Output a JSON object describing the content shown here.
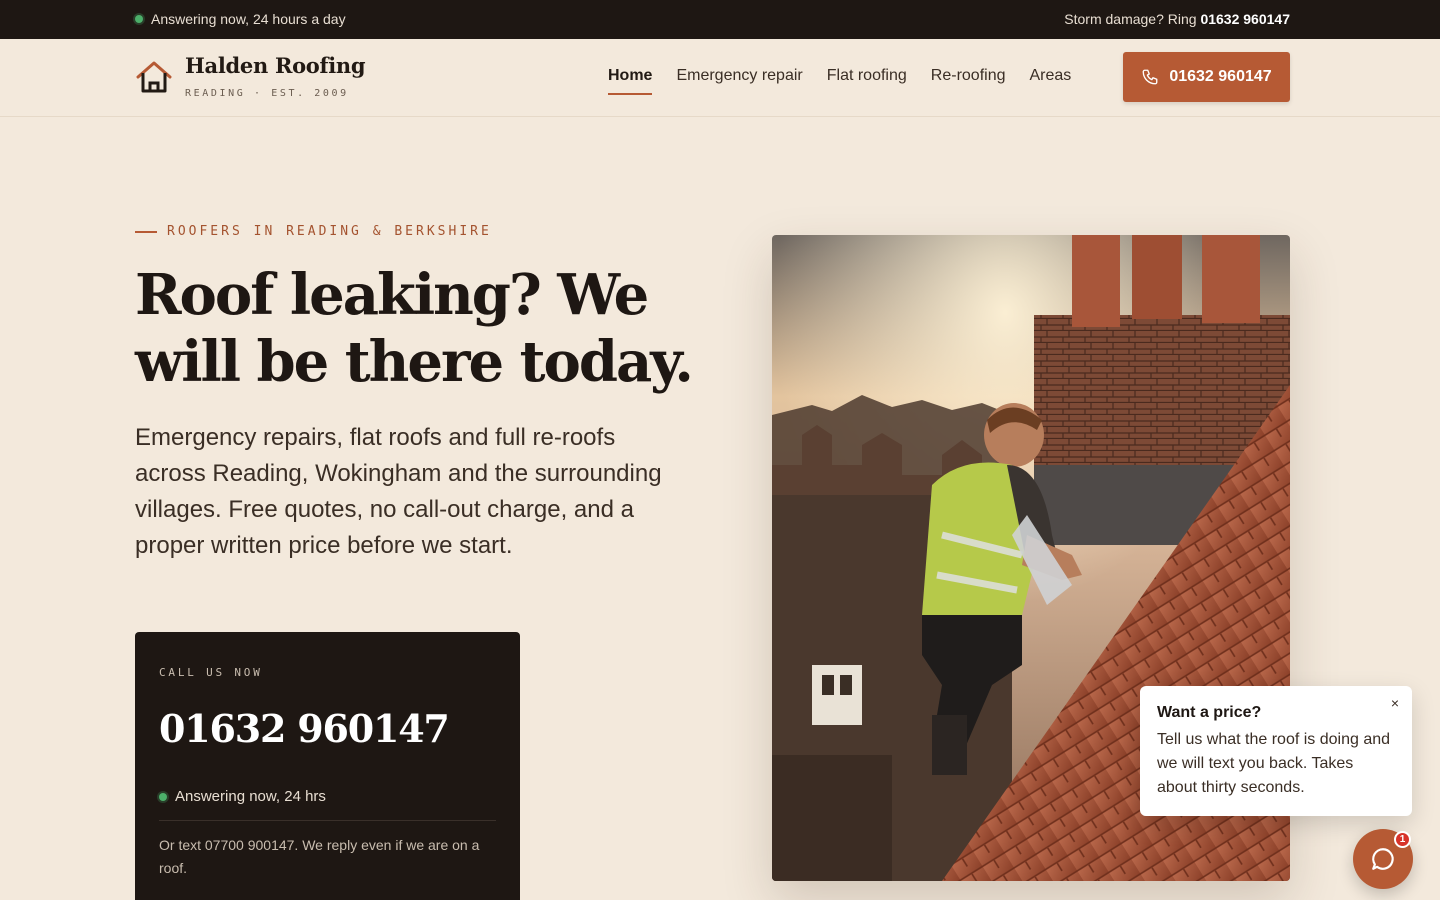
{
  "topbar": {
    "status": "Answering now, 24 hours a day",
    "storm_prefix": "Storm damage? Ring",
    "storm_phone": "01632 960147"
  },
  "header": {
    "brand": "Halden Roofing",
    "tagline": "READING · EST. 2009",
    "nav": [
      "Home",
      "Emergency repair",
      "Flat roofing",
      "Re-roofing",
      "Areas"
    ],
    "active_nav": "Home",
    "cta_phone": "01632 960147"
  },
  "hero": {
    "eyebrow": "ROOFERS IN READING & BERKSHIRE",
    "headline": "Roof leaking? We will be there today.",
    "lede": "Emergency repairs, flat roofs and full re-roofs across Reading, Wokingham and the surrounding villages. Free quotes, no call-out charge, and a proper written price before we start."
  },
  "callcard": {
    "label": "CALL US NOW",
    "phone": "01632 960147",
    "status": "Answering now, 24 hrs",
    "text_note": "Or text 07700 900147. We reply even if we are on a roof."
  },
  "chat": {
    "title": "Want a price?",
    "body": "Tell us what the roof is doing and we will text you back. Takes about thirty seconds.",
    "close": "×",
    "badge": "1"
  },
  "colors": {
    "accent": "#b65a34",
    "dark": "#1e1713",
    "background": "#f3e9dc",
    "status_green": "#4caf6a"
  },
  "icons": {
    "logo": "house-icon",
    "cta": "phone-icon",
    "chat": "chat-bubble-icon"
  }
}
